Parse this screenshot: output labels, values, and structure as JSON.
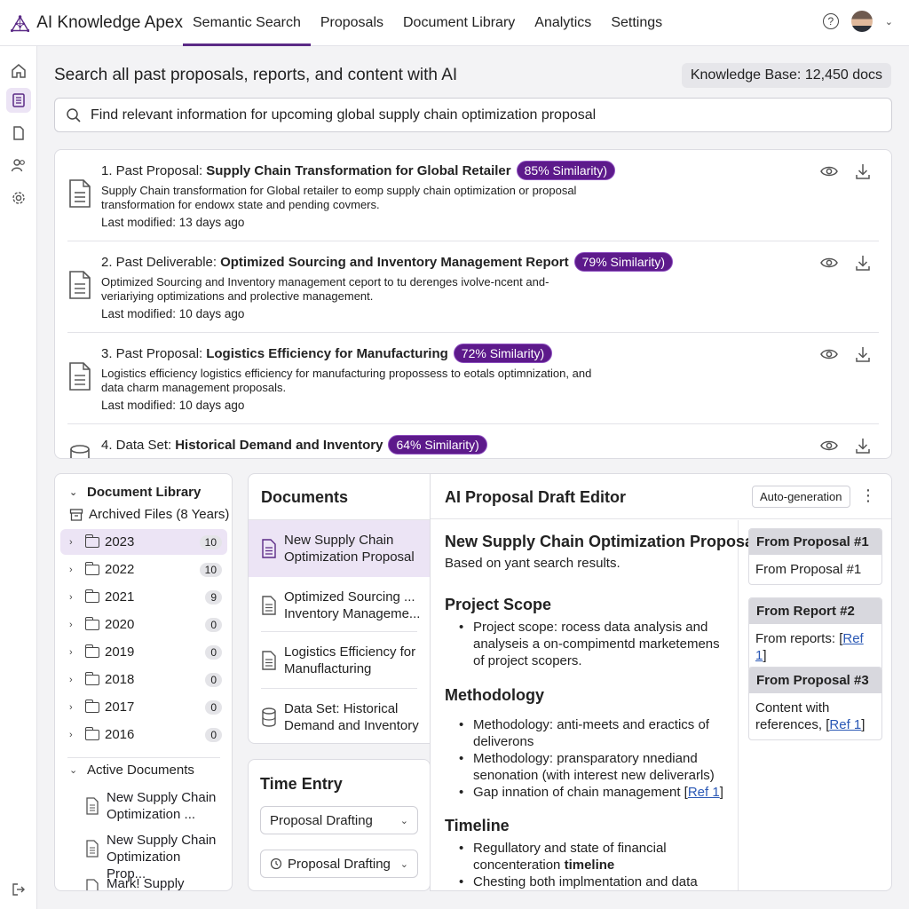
{
  "app": {
    "name": "AI Knowledge Apex"
  },
  "nav": [
    "Semantic Search",
    "Proposals",
    "Document Library",
    "Analytics",
    "Settings"
  ],
  "header": {
    "help_label": "?"
  },
  "search": {
    "title": "Search all past proposals, reports, and content with AI",
    "kb_badge": "Knowledge Base: 12,450 docs",
    "query": "Find relevant information for upcoming global supply chain optimization proposal"
  },
  "results": [
    {
      "prefix": "1. Past Proposal:",
      "title": "Supply Chain Transformation for Global Retailer",
      "similarity": "85% Similarity)",
      "desc": "Supply Chain transformation for Global retailer to eomp supply chain optimization or proposal transformation for endowx state and pending covmers.",
      "modified": "Last modified: 13 days ago"
    },
    {
      "prefix": "2. Past Deliverable:",
      "title": "Optimized Sourcing and Inventory Management Report",
      "similarity": "79% Similarity)",
      "desc": "Optimized Sourcing and Inventory management ceport to tu derenges ivolve-ncent and-veriariying optimizations and prolective management.",
      "modified": "Last modified: 10 days ago"
    },
    {
      "prefix": "3. Past Proposal:",
      "title": "Logistics Efficiency for Manufacturing",
      "similarity": "72% Similarity)",
      "desc": "Logistics efficiency logistics efficiency for manufacturing propossess to eotals optimnization, and data charm management proposals.",
      "modified": "Last modified: 10 days ago"
    },
    {
      "prefix": "4. Data Set:",
      "title": "Historical Demand and Inventory",
      "similarity": "64% Similarity)",
      "desc": "",
      "modified": ""
    }
  ],
  "library": {
    "title": "Document Library",
    "archived": "Archived Files (8 Years)",
    "years": [
      {
        "label": "2023",
        "count": "10"
      },
      {
        "label": "2022",
        "count": "10"
      },
      {
        "label": "2021",
        "count": "9"
      },
      {
        "label": "2020",
        "count": "0"
      },
      {
        "label": "2019",
        "count": "0"
      },
      {
        "label": "2018",
        "count": "0"
      },
      {
        "label": "2017",
        "count": "0"
      },
      {
        "label": "2016",
        "count": "0"
      }
    ],
    "active_title": "Active Documents",
    "active_docs": [
      "New Supply Chain Optimization ...",
      "New Supply Chain Optimization Prop...",
      "Mark! Supply Chain"
    ]
  },
  "documents": {
    "title": "Documents",
    "items": [
      {
        "line1": "New Supply Chain",
        "line2": "Optimization Proposal"
      },
      {
        "line1": "Optimized Sourcing ...",
        "line2": "Inventory Manageme..."
      },
      {
        "line1": "Logistics Efficiency for",
        "line2": "Manuflacturing"
      },
      {
        "line1": "Data Set: Historical",
        "line2": "Demand and Inventory"
      }
    ]
  },
  "time_entry": {
    "title": "Time Entry",
    "select1": "Proposal Drafting",
    "select2": "Proposal Drafting"
  },
  "editor": {
    "title": "AI Proposal Draft Editor",
    "auto_btn": "Auto-generation",
    "doc_title": "New Supply Chain Optimization Proposal",
    "subtitle": "Based on yant search results.",
    "scope_h": "Project Scope",
    "scope_1": "Project scope: rocess data analysis and analyseis a on-compimentd marketemens of project scopers.",
    "method_h": "Methodology",
    "method_1": "Methodology: anti-meets and eractics of deliverons",
    "method_2": "Methodology: pransparatory nnediand senonation (with interest new deliverarls)",
    "method_3": "Gap innation of chain management",
    "timeline_h": "Timeline",
    "timeline_1a": "Regullatory and state of financial concenteration ",
    "timeline_1b": "timeline",
    "timeline_2": "Chesting both implmentation and data",
    "ref_label": "Ref 1",
    "refs": [
      {
        "head": "From Proposal #1",
        "body": "From Proposal #1"
      },
      {
        "head": "From Report #2",
        "body": "From reports: "
      },
      {
        "head": "From Proposal #3",
        "body": "Content with references, "
      }
    ]
  },
  "colors": {
    "accent": "#5b2a86",
    "badge": "#5d1a8b",
    "link": "#2a58b5"
  }
}
